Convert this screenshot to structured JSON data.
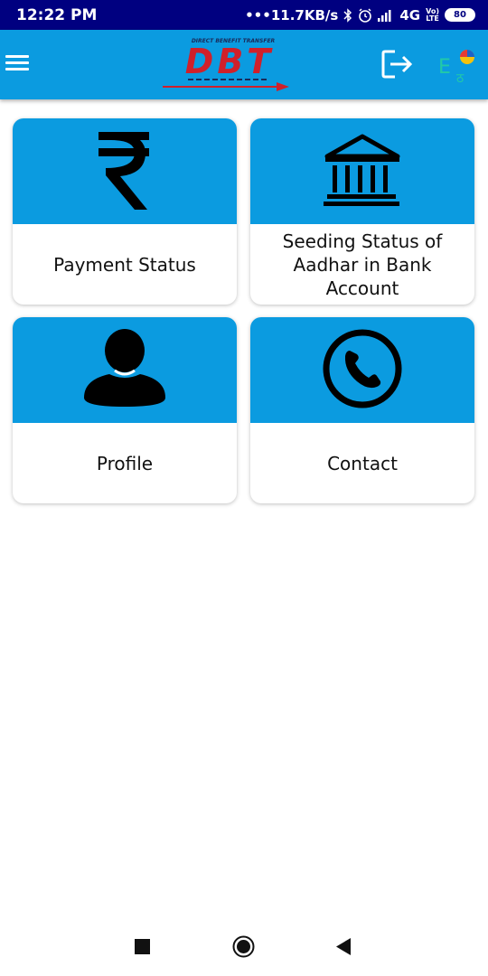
{
  "status_bar": {
    "time": "12:22 PM",
    "dots": "•••",
    "network_speed": "11.7KB/s",
    "network_type": "4G",
    "volte_top": "Vo)",
    "volte_bottom": "LTE",
    "battery": "80"
  },
  "app_bar": {
    "menu_icon": "hamburger-menu-icon",
    "logo_text": "DBT",
    "logo_tagline": "DIRECT BENEFIT TRANSFER",
    "logout_icon": "logout-icon",
    "language_icon": "language-switch-icon"
  },
  "cards": [
    {
      "label": "Payment Status",
      "icon": "rupee-icon"
    },
    {
      "label": "Seeding Status of Aadhar in Bank Account",
      "icon": "bank-icon"
    },
    {
      "label": "Profile",
      "icon": "user-icon"
    },
    {
      "label": "Contact",
      "icon": "phone-icon"
    }
  ],
  "colors": {
    "status_bar": "#000080",
    "primary": "#0b9be0",
    "logo_red": "#d0202a"
  }
}
